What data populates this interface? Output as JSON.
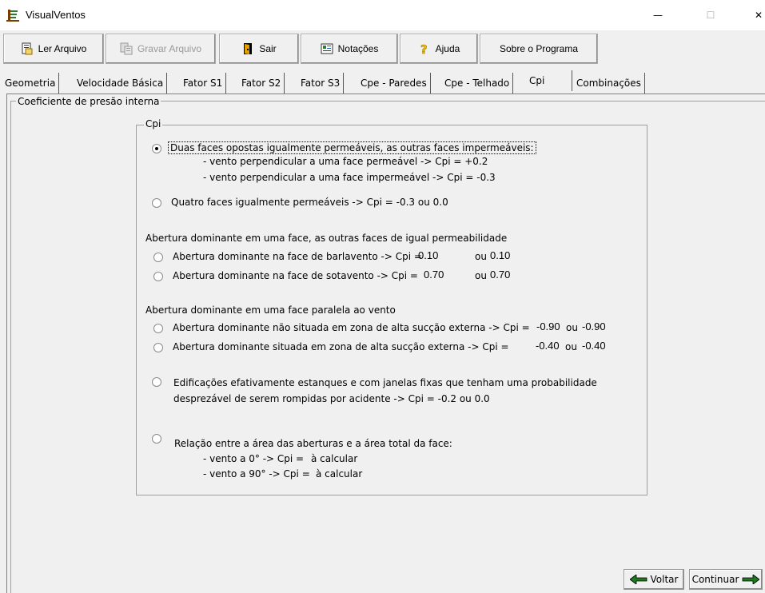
{
  "window": {
    "title": "VisualVentos",
    "controls": {
      "minimize": "—",
      "maximize": "☐",
      "close": "✕"
    }
  },
  "toolbar": {
    "buttons": [
      {
        "label": "Ler Arquivo",
        "icon": "open-file-icon",
        "enabled": true
      },
      {
        "label": "Gravar Arquivo",
        "icon": "save-file-icon",
        "enabled": false
      },
      {
        "label": "Sair",
        "icon": "exit-door-icon",
        "enabled": true
      },
      {
        "label": "Notações",
        "icon": "notes-icon",
        "enabled": true
      },
      {
        "label": "Ajuda",
        "icon": "help-icon",
        "enabled": true
      },
      {
        "label": "Sobre o Programa",
        "icon": "",
        "enabled": true
      }
    ]
  },
  "tabs": [
    {
      "label": "Geometria"
    },
    {
      "label": "Velocidade Básica"
    },
    {
      "label": "Fator S1"
    },
    {
      "label": "Fator S2"
    },
    {
      "label": "Fator S3"
    },
    {
      "label": "Cpe - Paredes"
    },
    {
      "label": "Cpe - Telhado"
    },
    {
      "label": "Cpi",
      "active": true
    },
    {
      "label": "Combinações"
    }
  ],
  "section": {
    "title": "Coeficiente de presão interna"
  },
  "group": {
    "title": "Cpi",
    "option1": {
      "selected": true,
      "label": "Duas faces opostas igualmente permeáveis, as outras faces impermeáveis:",
      "line1": "- vento perpendicular a uma face permeável -> Cpi = +0.2",
      "line2": "- vento perpendicular a uma face impermeável -> Cpi = -0.3"
    },
    "option2": {
      "selected": false,
      "label": "Quatro faces igualmente permeáveis -> Cpi = -0.3 ou 0.0"
    },
    "dominant_heading": "Abertura dominante em uma face, as outras faces de igual permeabilidade",
    "option3": {
      "selected": false,
      "label": "Abertura dominante na face de barlavento -> Cpi =",
      "value": "0.10",
      "ou": "ou",
      "alt": "0.10"
    },
    "option4": {
      "selected": false,
      "label": "Abertura dominante na face de sotavento -> Cpi =",
      "value": "0.70",
      "ou": "ou",
      "alt": "0.70"
    },
    "parallel_heading": "Abertura dominante em uma face paralela ao vento",
    "option5": {
      "selected": false,
      "label": "Abertura dominante não situada em zona de alta sucção externa -> Cpi =",
      "value": "-0.90",
      "ou": "ou",
      "alt": "-0.90"
    },
    "option6": {
      "selected": false,
      "label": "Abertura dominante situada em zona de alta sucção externa -> Cpi =",
      "value": "-0.40",
      "ou": "ou",
      "alt": "-0.40"
    },
    "option7": {
      "selected": false,
      "line1": "Edificações efativamente estanques e com janelas fixas que tenham uma probabilidade",
      "line2": "desprezável de serem rompidas por acidente -> Cpi = -0.2 ou 0.0"
    },
    "option8": {
      "selected": false,
      "label": "Relação entre a área das aberturas e a área total da face:",
      "line1_prefix": "- vento a 0° -> Cpi =",
      "line1_value": "à calcular",
      "line2_prefix": "- vento a 90° -> Cpi =",
      "line2_value": "à calcular"
    }
  },
  "nav": {
    "back": "Voltar",
    "next": "Continuar"
  },
  "colors": {
    "arrow_green": "#1f7a1f",
    "help_yellow": "#f0c000",
    "exit_red": "#c0392b"
  }
}
